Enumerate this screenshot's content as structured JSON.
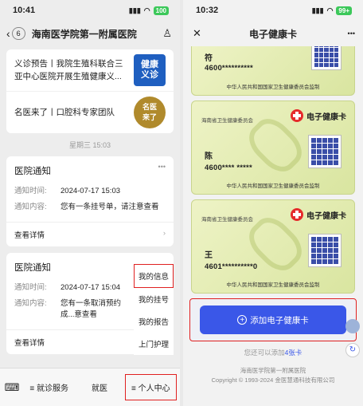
{
  "left": {
    "status": {
      "time": "10:41",
      "battery": "100"
    },
    "nav": {
      "badge": "6",
      "title": "海南医学院第一附属医院"
    },
    "news": [
      {
        "text": "义诊预告丨我院生殖科联合三亚中心医院开展生殖健康义...",
        "thumb": "健康\n义诊"
      },
      {
        "text": "名医来了丨口腔科专家团队",
        "thumb": "名医\n来了"
      }
    ],
    "timestamp": "星期三 15:03",
    "notices": [
      {
        "title": "医院通知",
        "time_label": "通知时间:",
        "time": "2024-07-17 15:03",
        "content_label": "通知内容:",
        "content": "您有一条挂号单，请注意查看",
        "link": "查看详情"
      },
      {
        "title": "医院通知",
        "time_label": "通知时间:",
        "time": "2024-07-17 15:04",
        "content_label": "通知内容:",
        "content": "您有一条取消预约成...意查看",
        "link": "查看详情"
      }
    ],
    "popup_menu": [
      "我的信息",
      "我的挂号",
      "我的报告",
      "上门护理"
    ],
    "tabs": [
      "≡ 就诊服务",
      "就医",
      "≡ 个人中心"
    ]
  },
  "right": {
    "status": {
      "time": "10:32",
      "battery": "99+"
    },
    "nav": {
      "title": "电子健康卡",
      "more": "•••"
    },
    "cards": [
      {
        "issuer": "",
        "title": "",
        "name": "符",
        "number": "4600**********",
        "footer": "中华人民共和国国家卫生健康委员会监制"
      },
      {
        "issuer": "海南省卫生健康委员会",
        "title": "电子健康卡",
        "name": "陈",
        "number": "4600****  *****",
        "footer": "中华人民共和国国家卫生健康委员会监制"
      },
      {
        "issuer": "海南省卫生健康委员会",
        "title": "电子健康卡",
        "name": "王",
        "number": "4601**********0",
        "footer": "中华人民共和国国家卫生健康委员会监制"
      }
    ],
    "add_button": "添加电子健康卡",
    "hint_prefix": "您还可以添加",
    "hint_count": "4张卡",
    "footer_line1": "海南医学院第一附属医院",
    "footer_line2": "Copyright © 1993-2024 金医慧通科技有限公司"
  },
  "colors": {
    "accent_blue": "#3a57e8",
    "highlight_red": "#e02020",
    "card_green": "#dfe9ab"
  }
}
